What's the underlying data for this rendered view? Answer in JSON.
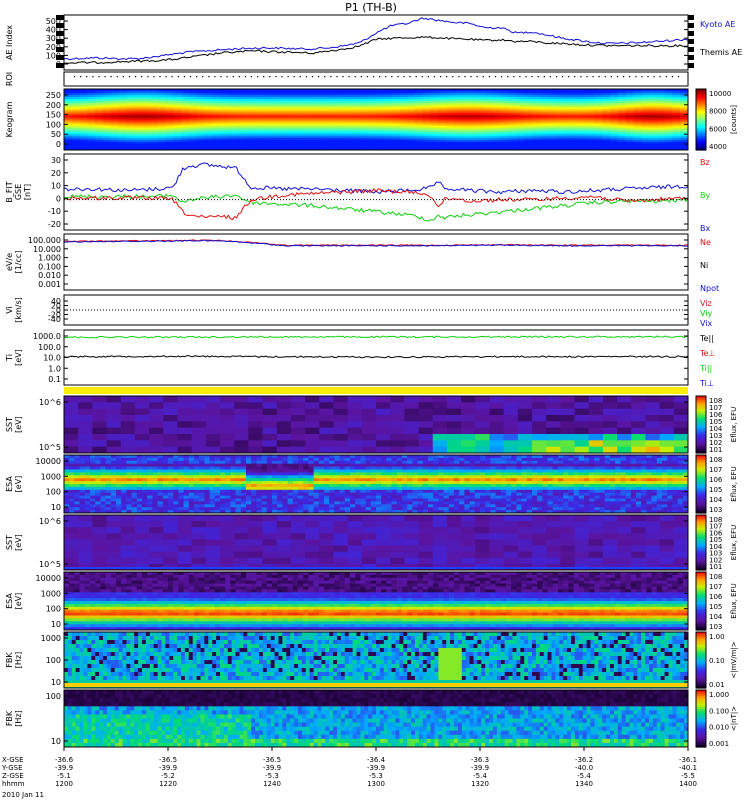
{
  "title": "P1 (TH-B)",
  "colors": {
    "blue": "#1010d0",
    "black": "#000000",
    "red": "#e01010",
    "green": "#10d010",
    "frame": "#000000"
  },
  "chart_data": [
    {
      "type": "line",
      "id": "ae",
      "ylabel": "AE Index",
      "yticks": [
        "500",
        "400",
        "300",
        "200",
        "100",
        "0"
      ],
      "ylim": [
        0,
        520
      ],
      "x": [
        1200,
        1205,
        1210,
        1215,
        1220,
        1225,
        1230,
        1235,
        1240,
        1245,
        1250,
        1255,
        1260,
        1265,
        1270,
        1275,
        1280,
        1285,
        1290,
        1295,
        1300,
        1305,
        1310,
        1315,
        1320,
        1325,
        1330,
        1335,
        1340,
        1345,
        1350,
        1355,
        1360,
        1365,
        1370,
        1375,
        1380,
        1385,
        1390,
        1395,
        1400
      ],
      "series": [
        {
          "name": "Kyoto AE",
          "color": "#1010d0",
          "values": [
            105,
            110,
            115,
            110,
            105,
            110,
            130,
            150,
            170,
            180,
            190,
            200,
            205,
            210,
            205,
            200,
            200,
            210,
            230,
            260,
            350,
            420,
            440,
            490,
            470,
            450,
            440,
            400,
            400,
            350,
            360,
            330,
            300,
            280,
            260,
            250,
            255,
            260,
            270,
            280,
            290
          ]
        },
        {
          "name": "Themis AE",
          "color": "#000000",
          "values": [
            65,
            70,
            70,
            75,
            80,
            85,
            90,
            100,
            120,
            140,
            160,
            170,
            180,
            175,
            170,
            165,
            160,
            180,
            200,
            230,
            290,
            300,
            305,
            310,
            305,
            295,
            290,
            280,
            285,
            270,
            270,
            255,
            250,
            240,
            235,
            230,
            230,
            230,
            230,
            230,
            230
          ]
        }
      ]
    },
    {
      "type": "heatmap",
      "id": "roi",
      "ylabel": "ROI",
      "ylabel2": ""
    },
    {
      "type": "heatmap",
      "id": "keogram",
      "ylabel": "Keogram",
      "yticks": [
        "250",
        "200",
        "150",
        "100",
        "50",
        "0"
      ],
      "colorbar": {
        "ticks": [
          "10000",
          "8000",
          "6000",
          "4000"
        ],
        "label": "[counts]"
      }
    },
    {
      "type": "line",
      "id": "bfield",
      "ylabel": "B_FIT",
      "ylabel2": "GSE",
      "ylabel3": "[nT]",
      "yticks": [
        "30",
        "20",
        "10",
        "0",
        "-10",
        "-20"
      ],
      "ylim": [
        -20,
        30
      ],
      "legend": [
        {
          "name": "Bz",
          "color": "#e01010"
        },
        {
          "name": "By",
          "color": "#10d010"
        },
        {
          "name": "Bx",
          "color": "#1010d0"
        }
      ],
      "x": [
        1200,
        1210,
        1220,
        1230,
        1235,
        1238,
        1240,
        1245,
        1250,
        1255,
        1260,
        1270,
        1280,
        1290,
        1300,
        1310,
        1315,
        1318,
        1320,
        1322,
        1325,
        1330,
        1340,
        1350,
        1360,
        1370,
        1380,
        1390,
        1400
      ],
      "series": [
        {
          "name": "Bx",
          "color": "#1010d0",
          "values": [
            7,
            7,
            6,
            7,
            8,
            20,
            22,
            23,
            22,
            21,
            8,
            7,
            7,
            6,
            5,
            6,
            7,
            8,
            12,
            6,
            7,
            6,
            5,
            6,
            5,
            6,
            7,
            8,
            9
          ]
        },
        {
          "name": "By",
          "color": "#10d010",
          "values": [
            2,
            2,
            2,
            2,
            3,
            -2,
            0,
            1,
            2,
            3,
            -2,
            -3,
            -4,
            -6,
            -8,
            -10,
            -12,
            -14,
            -10,
            -12,
            -11,
            -10,
            -8,
            -6,
            -4,
            -2,
            -1,
            -1,
            0
          ]
        },
        {
          "name": "Bz",
          "color": "#e01010",
          "values": [
            1,
            1,
            1,
            1,
            0,
            -8,
            -10,
            -12,
            -11,
            -12,
            0,
            3,
            4,
            5,
            6,
            5,
            4,
            2,
            -5,
            0,
            1,
            -1,
            0,
            0,
            1,
            2,
            -1,
            0,
            1
          ]
        }
      ]
    },
    {
      "type": "line",
      "id": "density",
      "ylabel": "eV/e",
      "ylabel2": "[1/cc]",
      "yticks": [
        "100.000",
        "10.000",
        "1.000",
        "0.100",
        "0.010",
        "0.001"
      ],
      "ylim_log": [
        -3,
        2
      ],
      "legend": [
        {
          "name": "Ne",
          "color": "#e01010"
        },
        {
          "name": "Ni",
          "color": "#000000"
        },
        {
          "name": "Npot",
          "color": "#1010d0"
        }
      ],
      "x": [
        1200,
        1220,
        1238,
        1240,
        1250,
        1260,
        1270,
        1300,
        1320,
        1340,
        1360,
        1380,
        1400
      ],
      "series": [
        {
          "name": "Ne",
          "color": "#e01010",
          "values": [
            22,
            24,
            26,
            28,
            26,
            18,
            10,
            10,
            10,
            11,
            10,
            10,
            10
          ]
        },
        {
          "name": "Npot",
          "color": "#1010d0",
          "values": [
            20,
            22,
            24,
            26,
            24,
            16,
            9,
            9,
            9,
            10,
            9,
            9,
            9
          ]
        }
      ]
    },
    {
      "type": "line",
      "id": "velocity",
      "ylabel": "Vi",
      "ylabel2": "[km/s]",
      "yticks": [
        "40",
        "20",
        "0",
        "-20",
        "-40"
      ],
      "ylim": [
        -50,
        50
      ],
      "legend": [
        {
          "name": "Viz",
          "color": "#e01010"
        },
        {
          "name": "Viy",
          "color": "#10d010"
        },
        {
          "name": "Vix",
          "color": "#1010d0"
        }
      ]
    },
    {
      "type": "line",
      "id": "temperature",
      "ylabel": "Ti",
      "ylabel2": "[eV]",
      "yticks": [
        "1000.0",
        "100.0",
        "10.0",
        "1.0",
        "0.1"
      ],
      "ylim_log": [
        -1.5,
        3.5
      ],
      "legend": [
        {
          "name": "Te||",
          "color": "#000000"
        },
        {
          "name": "Te⊥",
          "color": "#e01010"
        },
        {
          "name": "Ti||",
          "color": "#10d010"
        },
        {
          "name": "Ti⊥",
          "color": "#1010d0"
        }
      ],
      "x": [
        1200,
        1240,
        1260,
        1300,
        1340,
        1400
      ],
      "series": [
        {
          "name": "Ti||",
          "color": "#10d010",
          "values": [
            700,
            720,
            750,
            740,
            760,
            780
          ]
        },
        {
          "name": "Te||",
          "color": "#000000",
          "values": [
            12,
            13,
            12,
            11,
            12,
            12
          ]
        }
      ]
    },
    {
      "type": "heatmap",
      "id": "sst_e",
      "ylabel": "SST",
      "ylabel2": "[eV]",
      "yticks": [
        "10^6",
        "10^5"
      ],
      "colorbar": {
        "ticks": [
          "10^8",
          "10^7",
          "10^6",
          "10^5",
          "10^4",
          "10^3",
          "10^2",
          "10^1"
        ],
        "label": "Eflux, EFU"
      }
    },
    {
      "type": "heatmap",
      "id": "esa_e",
      "ylabel": "ESA",
      "ylabel2": "[eV]",
      "yticks": [
        "10000",
        "1000",
        "100",
        "10"
      ],
      "colorbar": {
        "ticks": [
          "10^8",
          "10^7",
          "10^6",
          "10^5",
          "10^4",
          "10^3"
        ],
        "label": "Eflux, EFU"
      }
    },
    {
      "type": "heatmap",
      "id": "sst_i",
      "ylabel": "SST",
      "ylabel2": "[eV]",
      "yticks": [
        "10^6",
        "10^5"
      ],
      "colorbar": {
        "ticks": [
          "10^8",
          "10^7",
          "10^6",
          "10^5",
          "10^4",
          "10^3",
          "10^2",
          "10^1"
        ],
        "label": "Eflux, EFU"
      }
    },
    {
      "type": "heatmap",
      "id": "esa_i",
      "ylabel": "ESA",
      "ylabel2": "[eV]",
      "yticks": [
        "10000",
        "1000",
        "100",
        "10"
      ],
      "colorbar": {
        "ticks": [
          "10^8",
          "10^7",
          "10^6",
          "10^5",
          "10^4",
          "10^3"
        ],
        "label": "Eflux, EFU"
      }
    },
    {
      "type": "heatmap",
      "id": "fbk_e",
      "ylabel": "FBK",
      "ylabel2": "[Hz]",
      "yticks": [
        "1000",
        "100",
        "10"
      ],
      "colorbar": {
        "ticks": [
          "1.00",
          "0.10",
          "0.01"
        ],
        "label": "<|mV/m|>"
      }
    },
    {
      "type": "heatmap",
      "id": "fbk_b",
      "ylabel": "FBK",
      "ylabel2": "[Hz]",
      "yticks": [
        "100",
        "10"
      ],
      "colorbar": {
        "ticks": [
          "1.000",
          "0.100",
          "0.010",
          "0.001"
        ],
        "label": "<|nT|>"
      }
    }
  ],
  "xaxis": {
    "rows": [
      {
        "label": "X-GSE",
        "values": [
          "-36.6",
          "-36.5",
          "-36.5",
          "-36.4",
          "-36.3",
          "-36.2",
          "-36.1"
        ]
      },
      {
        "label": "Y-GSE",
        "values": [
          "-39.9",
          "-39.9",
          "-39.9",
          "-39.9",
          "-39.9",
          "-40.0",
          "-40.1"
        ]
      },
      {
        "label": "Z-GSE",
        "values": [
          "-5.1",
          "-5.2",
          "-5.3",
          "-5.3",
          "-5.4",
          "-5.4",
          "-5.5"
        ]
      },
      {
        "label": "hhmm",
        "values": [
          "1200",
          "1220",
          "1240",
          "1300",
          "1320",
          "1340",
          "1400"
        ]
      }
    ],
    "date": "2010 Jan 11"
  }
}
